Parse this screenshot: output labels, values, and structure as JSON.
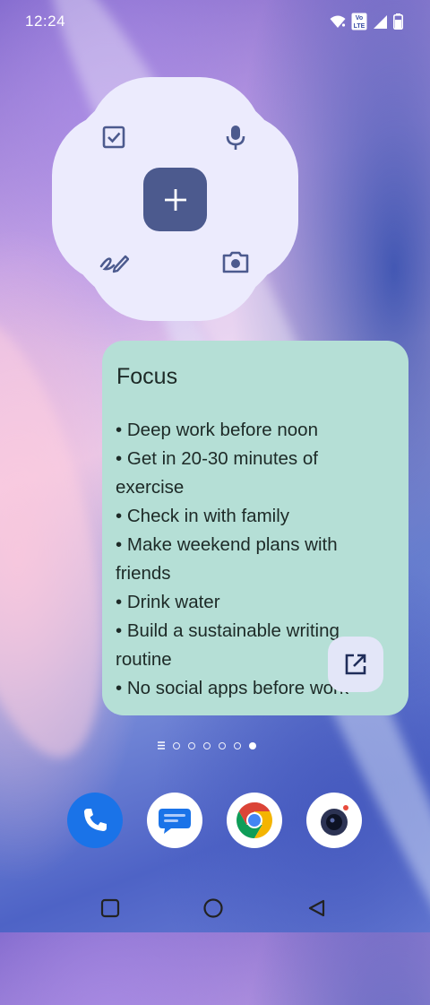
{
  "status_bar": {
    "time": "12:24",
    "icons": [
      "wifi-icon",
      "volte-icon",
      "signal-icon",
      "battery-icon"
    ],
    "volte_label_top": "Vo",
    "volte_label_bottom": "LTE"
  },
  "quick_note_widget": {
    "buttons": [
      "checklist-icon",
      "microphone-icon",
      "add-note-button",
      "handwriting-icon",
      "camera-icon"
    ]
  },
  "focus_note": {
    "title": "Focus",
    "items": [
      "• Deep work before noon",
      "• Get in 20-30 minutes of exercise",
      "• Check in with family",
      "• Make weekend plans with friends",
      "• Drink water",
      "• Build a sustainable writing routine",
      "• No social apps before work"
    ],
    "open_icon": "open-external-icon"
  },
  "page_indicator": {
    "pages": 6,
    "active_index": 5
  },
  "dock": {
    "apps": [
      "Phone",
      "Messages",
      "Chrome",
      "Camera"
    ]
  },
  "nav_bar": {
    "buttons": [
      "recents-button",
      "home-button",
      "back-button"
    ]
  },
  "colors": {
    "widget_bg": "#ECEBFD",
    "plus_button": "#4C5A8E",
    "note_bg": "#B5DFD6",
    "icon_color": "#4C5A8E"
  }
}
